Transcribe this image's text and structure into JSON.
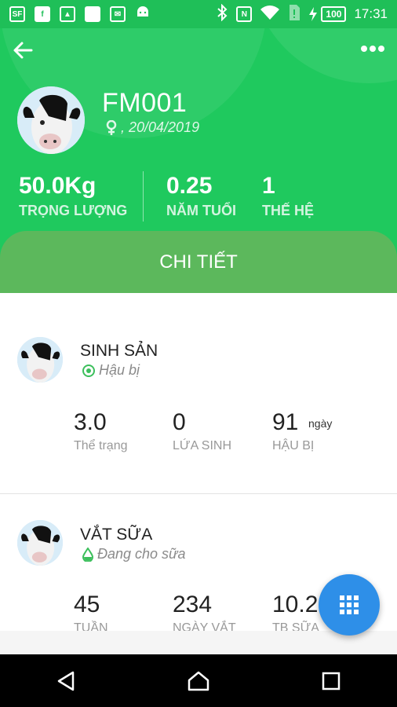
{
  "status_bar": {
    "time": "17:31",
    "battery": "100",
    "icons": [
      "sf-icon",
      "facebook-icon",
      "image-icon",
      "app-icon",
      "mail-icon",
      "android-icon",
      "bluetooth-icon",
      "nfc-icon",
      "wifi-icon",
      "sim-icon",
      "battery-icon"
    ]
  },
  "header": {
    "cow_name": "FM001",
    "cow_sub": ", 20/04/2019",
    "stats": [
      {
        "value": "50.0Kg",
        "label": "TRỌNG LƯỢNG"
      },
      {
        "value": "0.25",
        "label": "NĂM TUỔI"
      },
      {
        "value": "1",
        "label": "THẾ HỆ"
      }
    ],
    "detail_tab": "CHI TIẾT"
  },
  "reproduction": {
    "title": "SINH SẢN",
    "status": "Hậu bị",
    "metrics": [
      {
        "value": "3.0",
        "label": "Thể trạng"
      },
      {
        "value": "0",
        "label": "LỨA SINH"
      },
      {
        "value": "91",
        "unit": "ngày",
        "label": "HẬU BỊ"
      }
    ]
  },
  "milking": {
    "title": "VẮT SỮA",
    "status": "Đang cho sữa",
    "metrics": [
      {
        "value": "45",
        "label": "TUẦN"
      },
      {
        "value": "234",
        "label": "NGÀY VẮT"
      },
      {
        "value": "10.2",
        "label": "TB SỮA"
      }
    ]
  },
  "colors": {
    "header_green": "#1fc95e",
    "tab_green": "#5cb85c",
    "fab_blue": "#2e8fe8"
  }
}
